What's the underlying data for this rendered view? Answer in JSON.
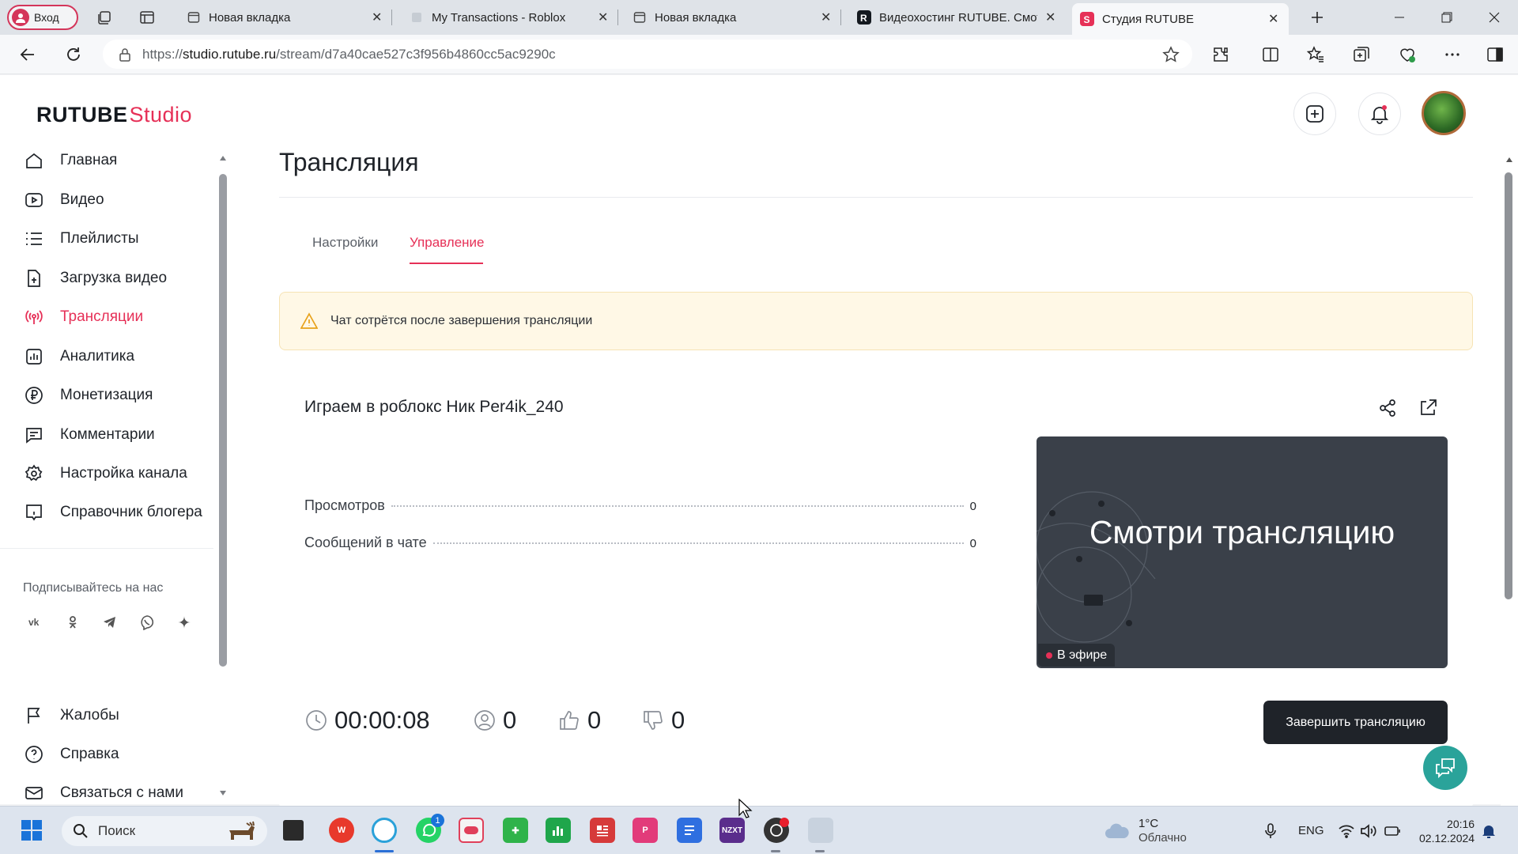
{
  "browser": {
    "profile_label": "Вход",
    "tabs": [
      {
        "title": "Новая вкладка"
      },
      {
        "title": "My Transactions - Roblox"
      },
      {
        "title": "Новая вкладка"
      },
      {
        "title": "Видеохостинг RUTUBE. Смотр"
      },
      {
        "title": "Студия RUTUBE"
      }
    ],
    "url_scheme": "https://",
    "url_host": "studio.rutube.ru",
    "url_path": "/stream/d7a40cae527c3f956b4860cc5ac9290c"
  },
  "app": {
    "logo_main": "RUTUBE",
    "logo_studio": "Studio",
    "accent_color": "#e63057"
  },
  "sidebar": {
    "items": [
      {
        "label": "Главная",
        "icon": "home-icon"
      },
      {
        "label": "Видео",
        "icon": "video-icon"
      },
      {
        "label": "Плейлисты",
        "icon": "playlist-icon"
      },
      {
        "label": "Загрузка видео",
        "icon": "upload-icon"
      },
      {
        "label": "Трансляции",
        "icon": "broadcast-icon"
      },
      {
        "label": "Аналитика",
        "icon": "analytics-icon"
      },
      {
        "label": "Монетизация",
        "icon": "ruble-icon"
      },
      {
        "label": "Комментарии",
        "icon": "comment-icon"
      },
      {
        "label": "Настройка канала",
        "icon": "gear-icon"
      },
      {
        "label": "Справочник блогера",
        "icon": "info-icon"
      }
    ],
    "subscribe_label": "Подписывайтесь на нас",
    "bottom_items": [
      {
        "label": "Жалобы",
        "icon": "flag-icon"
      },
      {
        "label": "Справка",
        "icon": "help-icon"
      },
      {
        "label": "Связаться с нами",
        "icon": "mail-icon"
      }
    ]
  },
  "main": {
    "title": "Трансляция",
    "tabs": [
      {
        "label": "Настройки"
      },
      {
        "label": "Управление"
      }
    ],
    "alert_text": "Чат сотрётся после завершения трансляции",
    "stream": {
      "title": "Играем в роблокс Ник Per4ik_240",
      "stats": [
        {
          "label": "Просмотров",
          "value": "0"
        },
        {
          "label": "Сообщений в чате",
          "value": "0"
        }
      ],
      "preview_text": "Смотри трансляцию",
      "live_badge": "В эфире",
      "duration": "00:00:08",
      "viewers": "0",
      "likes": "0",
      "dislikes": "0",
      "end_button": "Завершить трансляцию"
    }
  },
  "taskbar": {
    "search_placeholder": "Поиск",
    "whatsapp_badge": "1",
    "weather_temp": "1°C",
    "weather_desc": "Облачно",
    "language": "ENG",
    "time": "20:16",
    "date": "02.12.2024"
  }
}
